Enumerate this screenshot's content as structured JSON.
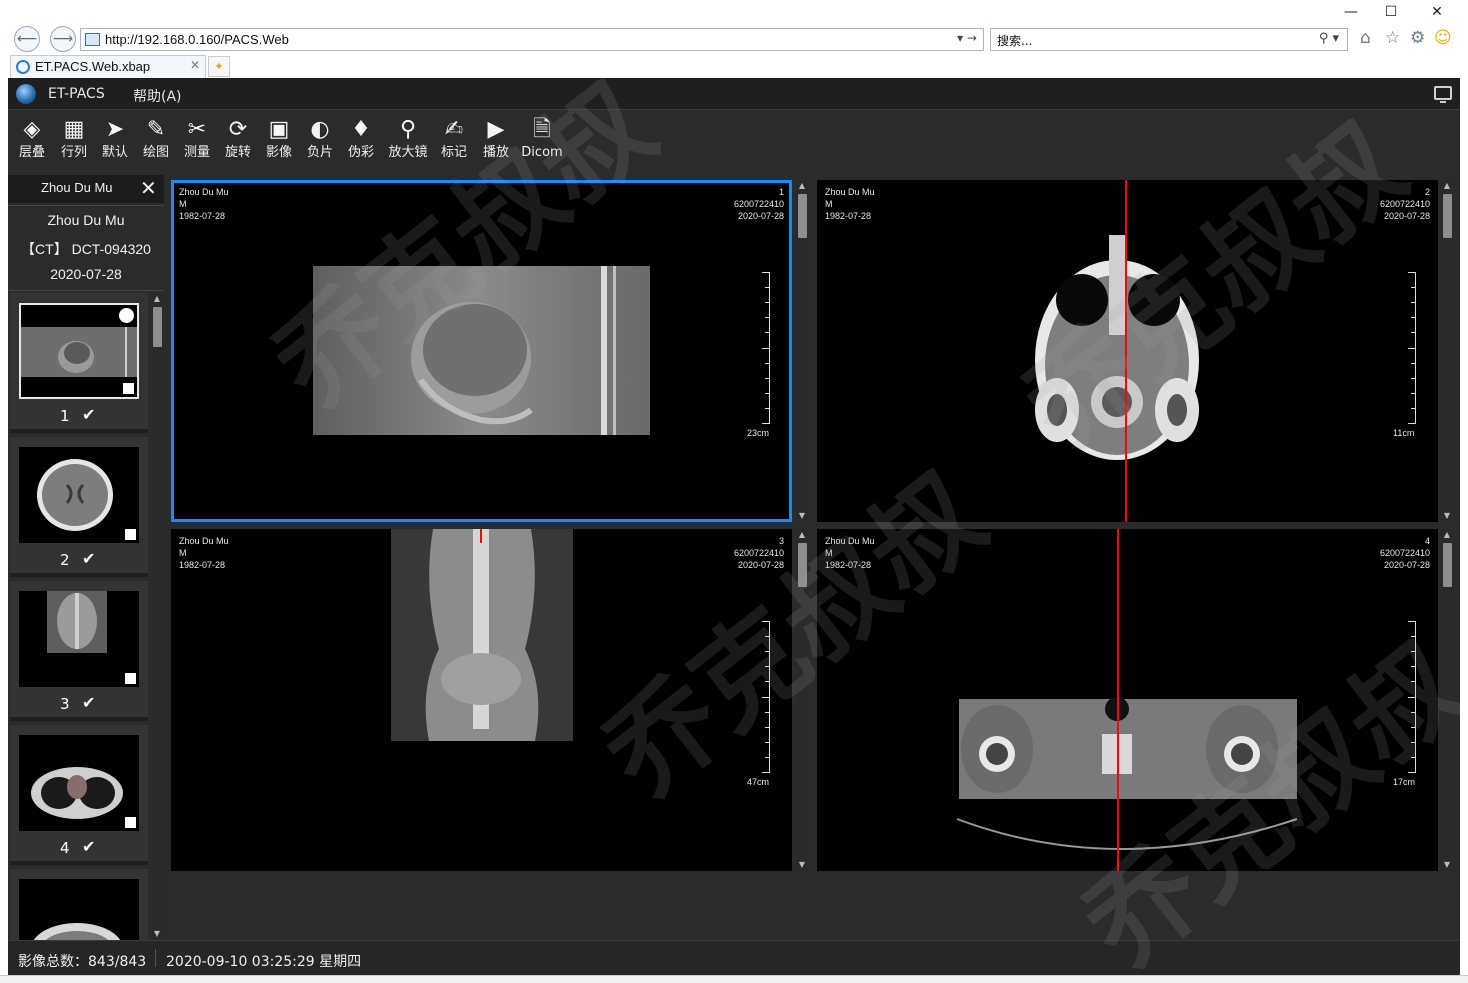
{
  "browser": {
    "window_controls": {
      "minimize": "—",
      "maximize": "☐",
      "close": "✕"
    },
    "address": "http://192.168.0.160/PACS.Web",
    "search_placeholder": "搜索...",
    "tab_title": "ET.PACS.Web.xbap"
  },
  "app": {
    "title": "ET-PACS",
    "menu_help": "帮助(A)"
  },
  "toolbar": [
    {
      "id": "stack",
      "label": "层叠",
      "icon": "layers-icon",
      "glyph": "◈"
    },
    {
      "id": "grid",
      "label": "行列",
      "icon": "grid-icon",
      "glyph": "▦"
    },
    {
      "id": "default",
      "label": "默认",
      "icon": "pointer-icon",
      "glyph": "➤"
    },
    {
      "id": "draw",
      "label": "绘图",
      "icon": "pencil-icon",
      "glyph": "✎"
    },
    {
      "id": "measure",
      "label": "测量",
      "icon": "measure-icon",
      "glyph": "✂"
    },
    {
      "id": "rotate",
      "label": "旋转",
      "icon": "rotate-icon",
      "glyph": "⟳"
    },
    {
      "id": "image",
      "label": "影像",
      "icon": "dicom-image-icon",
      "glyph": "▣"
    },
    {
      "id": "negative",
      "label": "负片",
      "icon": "invert-icon",
      "glyph": "◐"
    },
    {
      "id": "pseudo",
      "label": "伪彩",
      "icon": "paint-bucket-icon",
      "glyph": "♦"
    },
    {
      "id": "magnify",
      "label": "放大镜",
      "icon": "magnifier-icon",
      "glyph": "⚲"
    },
    {
      "id": "mark",
      "label": "标记",
      "icon": "annotate-icon",
      "glyph": "✍"
    },
    {
      "id": "play",
      "label": "播放",
      "icon": "video-icon",
      "glyph": "▶"
    },
    {
      "id": "dicom",
      "label": "Dicom",
      "icon": "dicom-doc-icon",
      "glyph": "🗎"
    }
  ],
  "patient": {
    "tab_name": "Zhou Du Mu",
    "name": "Zhou Du Mu",
    "study": "【CT】 DCT-094320",
    "date": "2020-07-28"
  },
  "series": [
    {
      "num": "1",
      "check": "✔"
    },
    {
      "num": "2",
      "check": "✔"
    },
    {
      "num": "3",
      "check": "✔"
    },
    {
      "num": "4",
      "check": "✔"
    }
  ],
  "viewports": [
    {
      "index": "1",
      "name": "Zhou Du Mu",
      "sex": "M",
      "birth": "1982-07-28",
      "id": "6200722410",
      "date": "2020-07-28",
      "scale": "23cm"
    },
    {
      "index": "2",
      "name": "Zhou Du Mu",
      "sex": "M",
      "birth": "1982-07-28",
      "id": "6200722410",
      "date": "2020-07-28",
      "scale": "11cm"
    },
    {
      "index": "3",
      "name": "Zhou Du Mu",
      "sex": "M",
      "birth": "1982-07-28",
      "id": "6200722410",
      "date": "2020-07-28",
      "scale": "47cm"
    },
    {
      "index": "4",
      "name": "Zhou Du Mu",
      "sex": "M",
      "birth": "1982-07-28",
      "id": "6200722410",
      "date": "2020-07-28",
      "scale": "17cm"
    }
  ],
  "status": {
    "total": "影像总数：843/843",
    "datetime": "2020-09-10 03:25:29 星期四"
  },
  "watermark_text": "乔克叔叔",
  "colors": {
    "accent": "#1e88ff",
    "crosshair": "#e01010",
    "background": "#2b2b2b"
  }
}
